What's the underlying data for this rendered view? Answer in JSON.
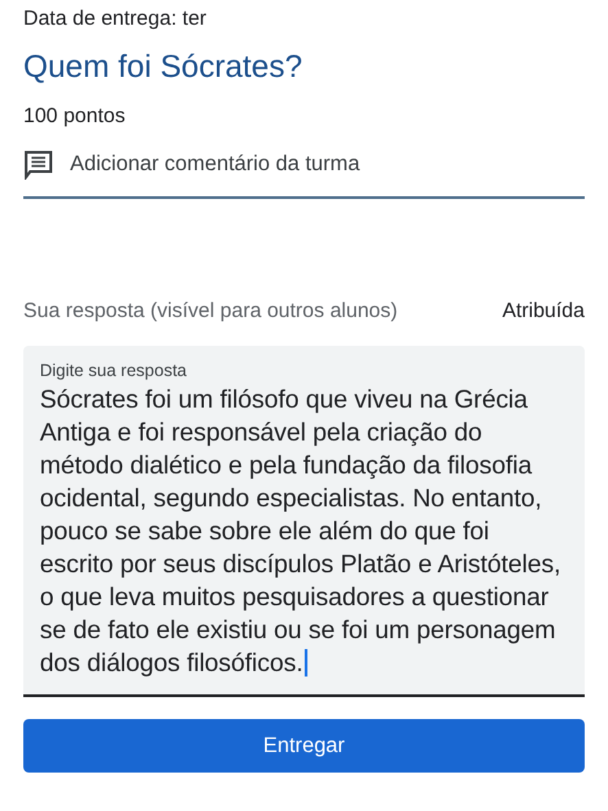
{
  "due_date": "Data de entrega: ter",
  "title": "Quem foi Sócrates?",
  "points": "100 pontos",
  "class_comment": "Adicionar comentário da turma",
  "answer_heading": "Sua resposta (visível para outros alunos)",
  "status": "Atribuída",
  "answer_field": {
    "label": "Digite sua resposta",
    "value": "Sócrates foi um filósofo que viveu na Grécia Antiga e foi responsável pela criação do método dialético e pela fundação da filosofia ocidental, segundo especialistas. No entanto, pouco se sabe sobre ele além do que foi escrito por seus discípulos Platão e Aristóteles, o que leva muitos pesquisadores a questionar se de fato ele existiu ou se foi um personagem dos diálogos filosóficos.",
    "focused": true
  },
  "submit_button": "Entregar"
}
